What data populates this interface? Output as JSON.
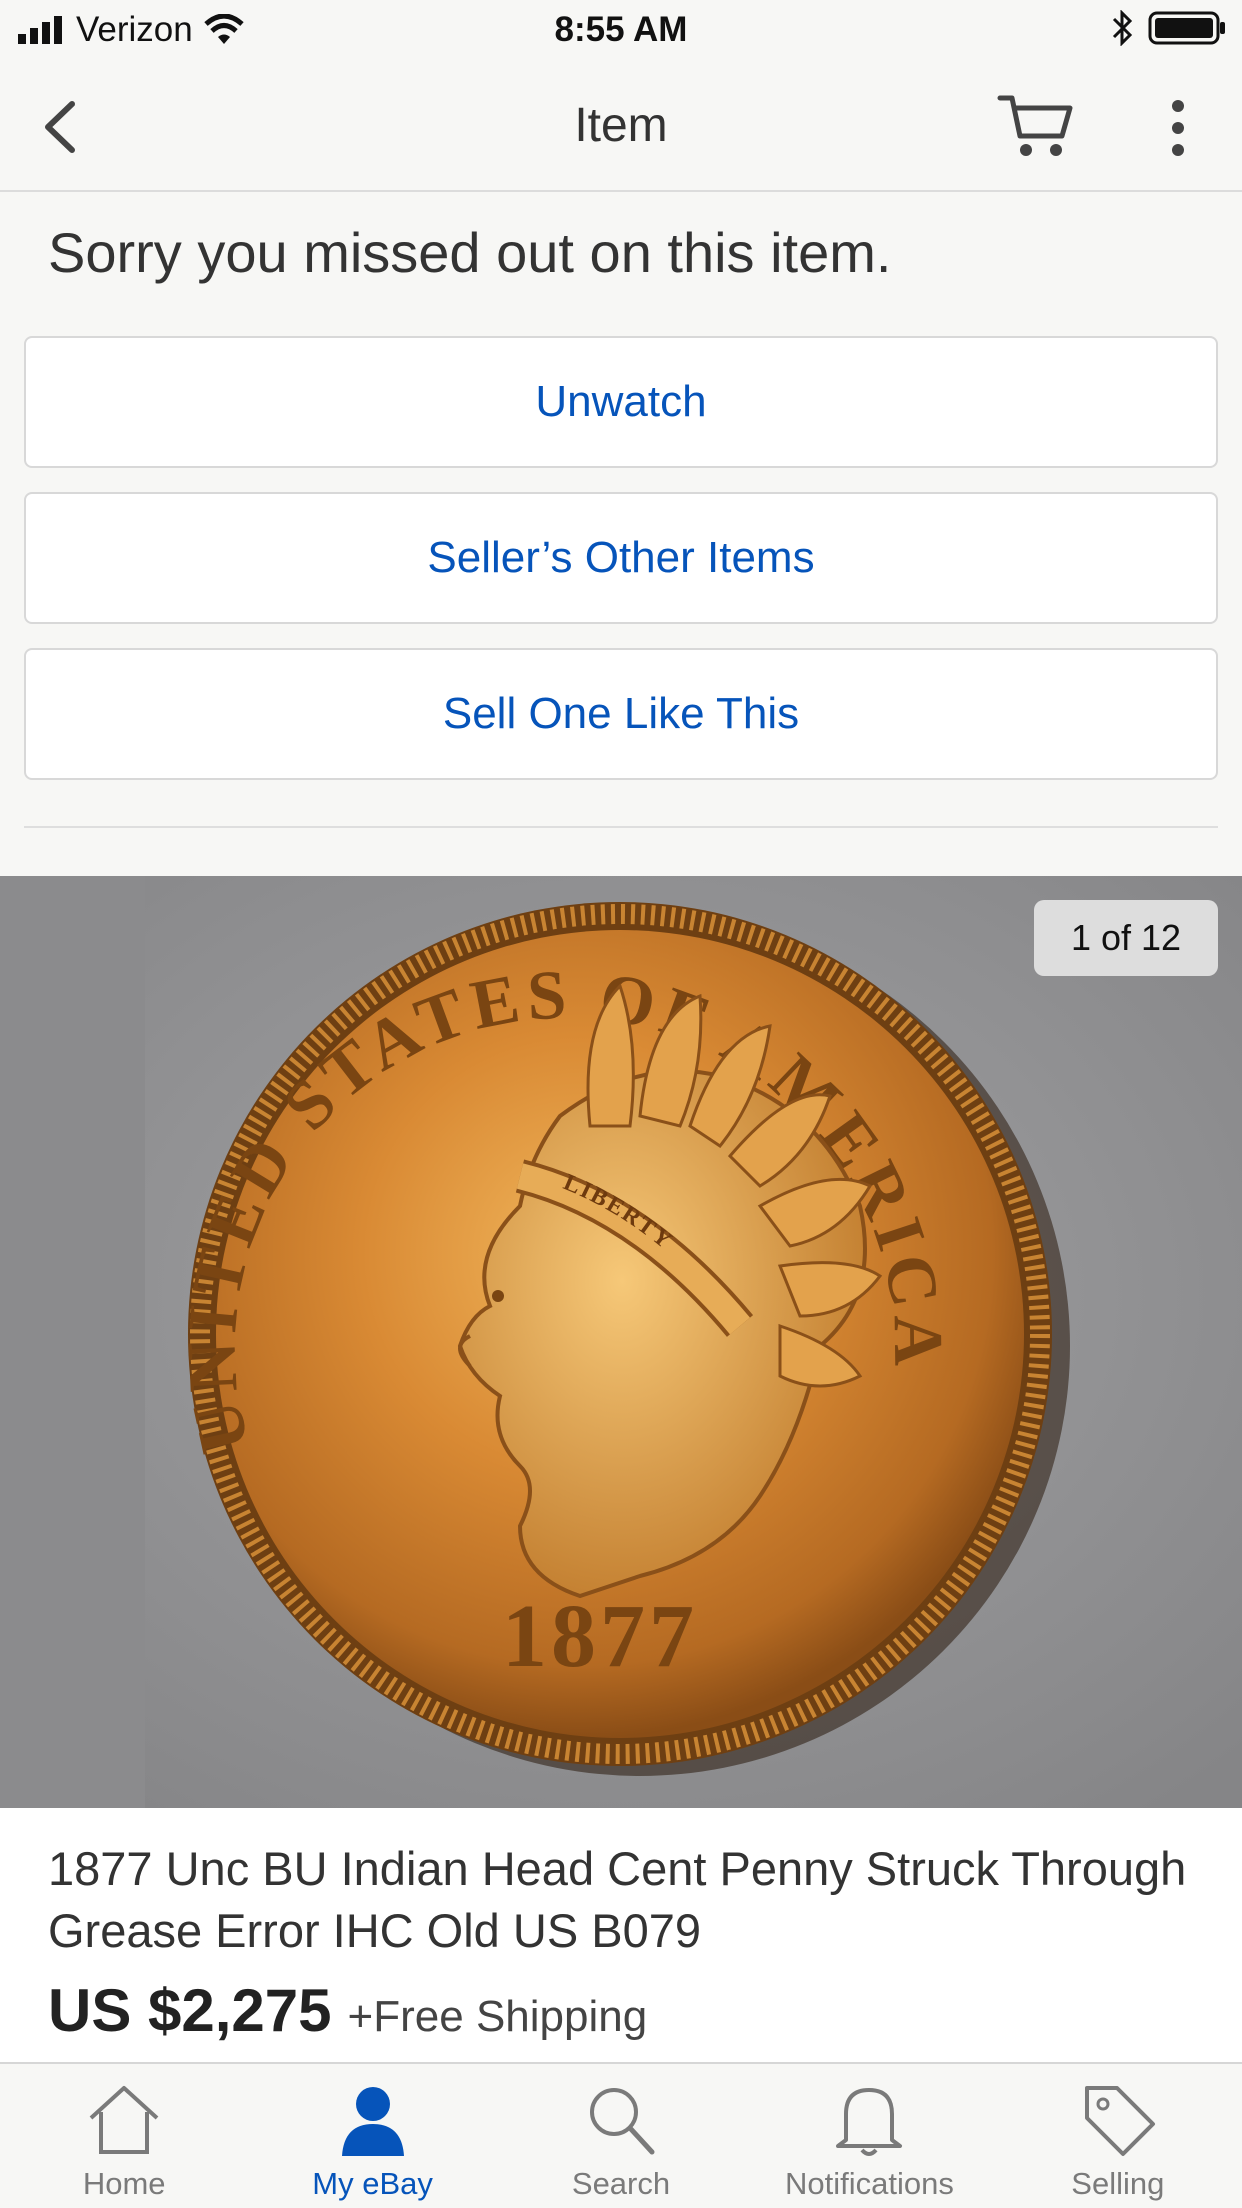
{
  "status_bar": {
    "carrier": "Verizon",
    "time": "8:55 AM"
  },
  "nav": {
    "title": "Item"
  },
  "message": "Sorry you missed out on this item.",
  "actions": {
    "unwatch": "Unwatch",
    "sellers_other_items": "Seller’s Other Items",
    "sell_one_like_this": "Sell One Like This"
  },
  "gallery": {
    "counter": "1 of 12",
    "coin": {
      "legend_top": "UNITED STATES OF AMERICA",
      "headband": "LIBERTY",
      "date": "1877"
    }
  },
  "item": {
    "title": "1877 Unc BU Indian Head Cent Penny Struck Through Grease Error IHC Old US B079",
    "price": "US $2,275",
    "shipping": "+Free Shipping"
  },
  "tabs": [
    {
      "label": "Home",
      "icon": "home-icon",
      "active": false
    },
    {
      "label": "My eBay",
      "icon": "person-icon",
      "active": true
    },
    {
      "label": "Search",
      "icon": "search-icon",
      "active": false
    },
    {
      "label": "Notifications",
      "icon": "bell-icon",
      "active": false
    },
    {
      "label": "Selling",
      "icon": "tag-icon",
      "active": false
    }
  ],
  "colors": {
    "link_blue": "#0654ba",
    "coin_copper": "#c97a2a"
  }
}
